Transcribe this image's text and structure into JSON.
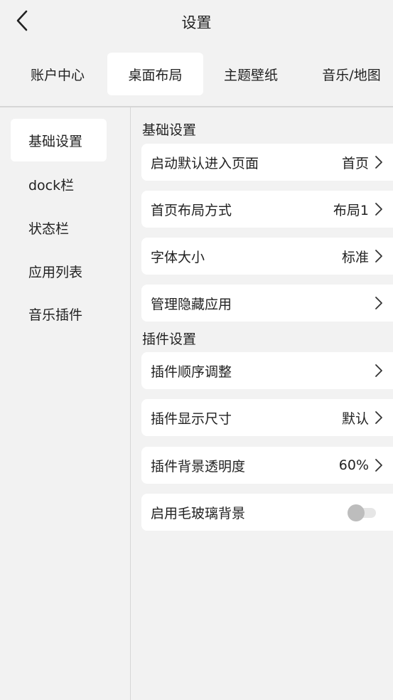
{
  "header": {
    "title": "设置"
  },
  "tabs": [
    {
      "label": "账户中心"
    },
    {
      "label": "桌面布局"
    },
    {
      "label": "主题壁纸"
    },
    {
      "label": "音乐/地图"
    }
  ],
  "sidebar": {
    "items": [
      {
        "label": "基础设置"
      },
      {
        "label": "dock栏"
      },
      {
        "label": "状态栏"
      },
      {
        "label": "应用列表"
      },
      {
        "label": "音乐插件"
      }
    ]
  },
  "sections": {
    "basic": {
      "title": "基础设置",
      "rows": [
        {
          "label": "启动默认进入页面",
          "value": "首页"
        },
        {
          "label": "首页布局方式",
          "value": "布局1"
        },
        {
          "label": "字体大小",
          "value": "标准"
        },
        {
          "label": "管理隐藏应用",
          "value": ""
        }
      ]
    },
    "plugin": {
      "title": "插件设置",
      "rows": [
        {
          "label": "插件顺序调整",
          "value": ""
        },
        {
          "label": "插件显示尺寸",
          "value": "默认"
        },
        {
          "label": "插件背景透明度",
          "value": "60%"
        },
        {
          "label": "启用毛玻璃背景",
          "toggle_on": false
        }
      ]
    }
  },
  "colors": {
    "background": "#f2f2f2",
    "card": "#ffffff",
    "text": "#222222",
    "toggle_off_knob": "#bdbdbd"
  }
}
